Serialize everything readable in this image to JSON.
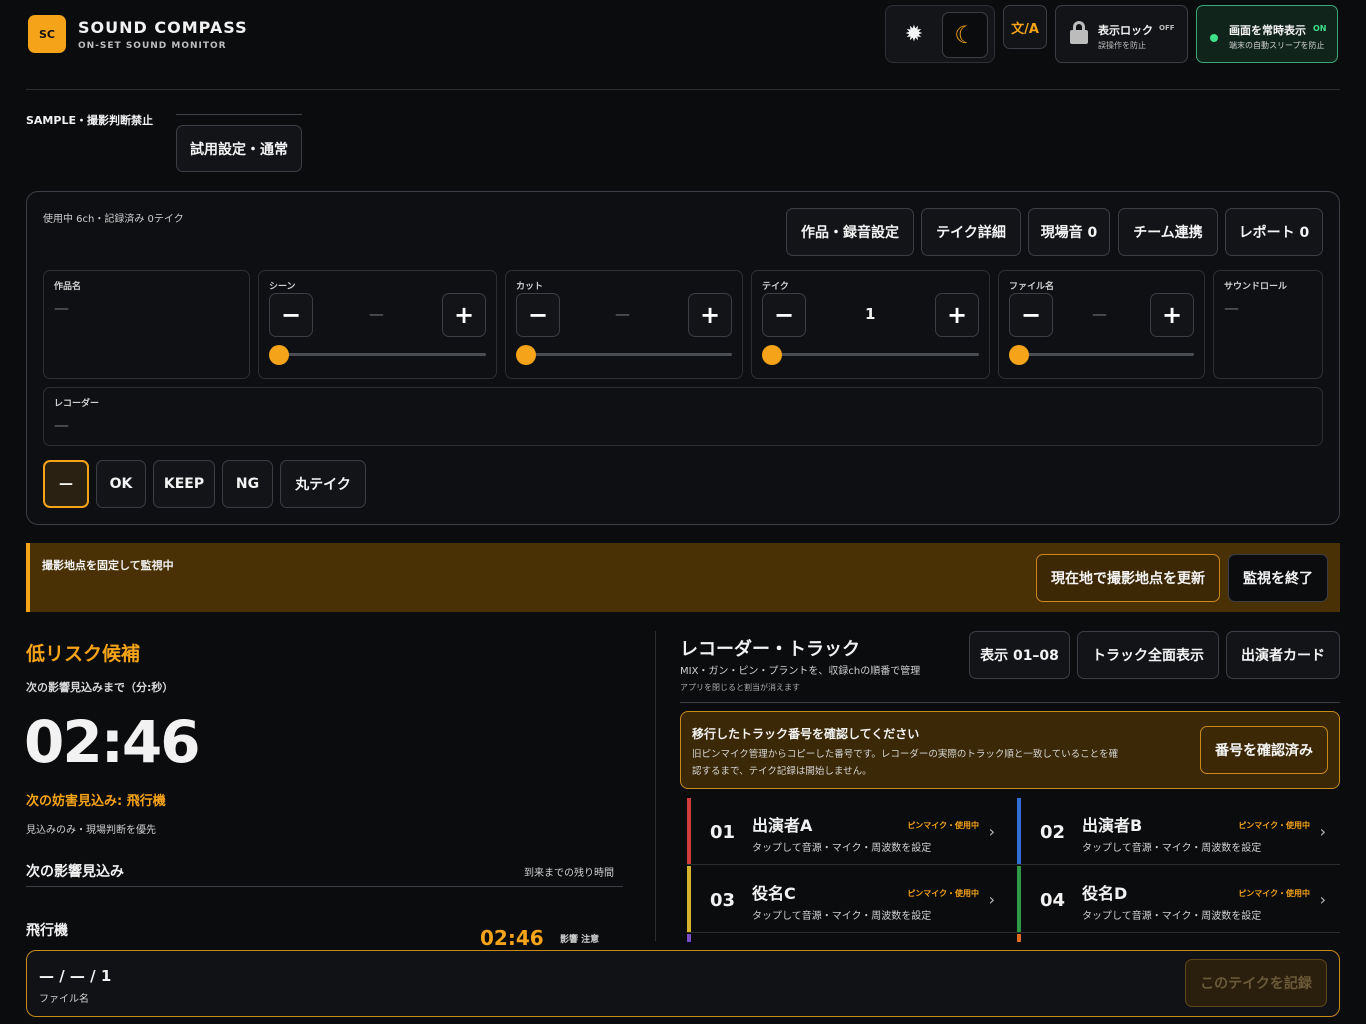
{
  "app": {
    "logo": "SC",
    "title": "SOUND COMPASS",
    "subtitle": "ON-SET SOUND MONITOR"
  },
  "header": {
    "lang_label": "文/A",
    "lock": {
      "title": "表示ロック",
      "state": "OFF",
      "sub": "誤操作を防止"
    },
    "awake": {
      "title": "画面を常時表示",
      "state": "ON",
      "sub": "端末の自動スリープを防止"
    }
  },
  "mode": {
    "sample_label": "SAMPLE・撮影判断禁止",
    "preset_button": "試用設定・通常"
  },
  "panel": {
    "usage": "使用中 6ch・記録済み 0テイク",
    "tabs": [
      "作品・録音設定",
      "テイク詳細",
      "現場音 0",
      "チーム連携",
      "レポート 0"
    ],
    "fields": {
      "work": {
        "label": "作品名",
        "value": "—"
      },
      "scene": {
        "label": "シーン",
        "value": "—",
        "minus": "−",
        "plus": "+"
      },
      "cut": {
        "label": "カット",
        "value": "—",
        "minus": "−",
        "plus": "+"
      },
      "take": {
        "label": "テイク",
        "value": "1",
        "minus": "−",
        "plus": "+"
      },
      "file": {
        "label": "ファイル名",
        "value": "—",
        "minus": "−",
        "plus": "+"
      },
      "roll": {
        "label": "サウンドロール",
        "value": "—"
      },
      "recorder": {
        "label": "レコーダー",
        "value": "—"
      }
    },
    "status_buttons": [
      "—",
      "OK",
      "KEEP",
      "NG",
      "丸テイク"
    ]
  },
  "monitor_bar": {
    "text": "撮影地点を固定して監視中",
    "update_button": "現在地で撮影地点を更新",
    "stop_button": "監視を終了"
  },
  "risk": {
    "title": "低リスク候補",
    "countdown_label": "次の影響見込みまで（分:秒）",
    "countdown": "02:46",
    "next_obstacle": "次の妨害見込み: 飛行機",
    "note": "見込みのみ・現場判断を優先",
    "section_title": "次の影響見込み",
    "section_right": "到来までの残り時間",
    "item_name": "飛行機",
    "item_time": "02:46",
    "item_tags": "影響 注意"
  },
  "tracks": {
    "title": "レコーダー・トラック",
    "sub1": "MIX・ガン・ピン・プラントを、収録chの順番で管理",
    "sub2": "アプリを閉じると割当が消えます",
    "buttons": [
      "表示 01–08",
      "トラック全面表示",
      "出演者カード"
    ],
    "notice": {
      "title": "移行したトラック番号を確認してください",
      "body1": "旧ピンマイク管理からコピーした番号です。レコーダーの実際のトラック順と一致していることを確",
      "body2": "認するまで、テイク記録は開始しません。",
      "button": "番号を確認済み"
    },
    "items": [
      {
        "num": "01",
        "name": "出演者A",
        "tag": "ピンマイク・使用中",
        "sub": "タップして音源・マイク・周波数を設定",
        "color": "#d13b3b"
      },
      {
        "num": "02",
        "name": "出演者B",
        "tag": "ピンマイク・使用中",
        "sub": "タップして音源・マイク・周波数を設定",
        "color": "#2f6fd6"
      },
      {
        "num": "03",
        "name": "役名C",
        "tag": "ピンマイク・使用中",
        "sub": "タップして音源・マイク・周波数を設定",
        "color": "#d8b32c"
      },
      {
        "num": "04",
        "name": "役名D",
        "tag": "ピンマイク・使用中",
        "sub": "タップして音源・マイク・周波数を設定",
        "color": "#2f9a45"
      }
    ],
    "arrow": "›"
  },
  "footer": {
    "take_id": "— / — / 1",
    "file_label": "ファイル名",
    "record_button": "このテイクを記録"
  }
}
